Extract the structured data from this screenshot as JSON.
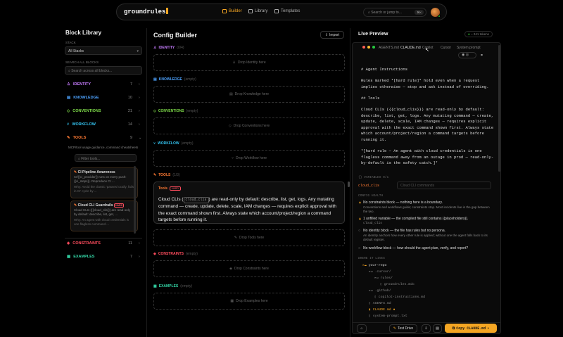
{
  "nav": {
    "brand": "groundrules",
    "tabs": [
      {
        "label": "Builder"
      },
      {
        "label": "Library"
      },
      {
        "label": "Templates"
      }
    ],
    "search_placeholder": "Search or jump to...",
    "search_kbd": "⌘K",
    "accent": "#f5a623"
  },
  "library": {
    "title": "Block Library",
    "stack_label": "STACK",
    "stack_value": "All Stacks",
    "search_label": "SEARCH ALL BLOCKS",
    "search_placeholder": "Search across all blocks...",
    "categories": [
      {
        "label": "IDENTITY",
        "count": "7",
        "color": "#c77dff"
      },
      {
        "label": "KNOWLEDGE",
        "count": "10",
        "color": "#4da3ff"
      },
      {
        "label": "CONVENTIONS",
        "count": "21",
        "color": "#7fdc4a"
      },
      {
        "label": "WORKFLOW",
        "count": "14",
        "color": "#33c3f0"
      },
      {
        "label": "TOOLS",
        "count": "9",
        "color": "#ff7a33"
      },
      {
        "label": "CONSTRAINTS",
        "count": "11",
        "color": "#ff4d5e"
      },
      {
        "label": "EXAMPLES",
        "count": "7",
        "color": "#33d6a6"
      }
    ],
    "tools_desc": "MCP/tool usage guidance, command cheatsheets",
    "tools_filter_placeholder": "Filter tools...",
    "cards": [
      {
        "title": "CI Pipeline Awareness",
        "body": "CI/{{ci_provider}} runs on every push: {{ci_steps}}. Reproduce CI ...",
        "why": "Why: Avoid the classic 'passes locally, fails in CI' cycle by ..."
      },
      {
        "title": "Cloud CLI Guardrails",
        "badge": "HARD",
        "body": "Cloud CLIs ({{cloud_clis}}) are read-only by default: describe, list, get, ...",
        "why": "Why: An agent with cloud credentials is one flagless command ..."
      }
    ]
  },
  "builder": {
    "title": "Config Builder",
    "import_label": "Import",
    "sections": [
      {
        "label": "IDENTITY",
        "tag": "(0/4)",
        "drop": "Drop Identity here",
        "color": "#c77dff"
      },
      {
        "label": "KNOWLEDGE",
        "tag": "(empty)",
        "drop": "Drop Knowledge here",
        "color": "#4da3ff"
      },
      {
        "label": "CONVENTIONS",
        "tag": "(empty)",
        "drop": "Drop Conventions here",
        "color": "#7fdc4a"
      },
      {
        "label": "WORKFLOW",
        "tag": "(empty)",
        "drop": "Drop Workflow here",
        "color": "#33c3f0"
      },
      {
        "label": "TOOLS",
        "tag": "(1/3)",
        "drop": "Drop Tools here",
        "color": "#ff7a33"
      },
      {
        "label": "CONSTRAINTS",
        "tag": "(empty)",
        "drop": "Drop Constraints here",
        "color": "#ff4d5e"
      },
      {
        "label": "EXAMPLES",
        "tag": "(empty)",
        "drop": "Drop Examples here",
        "color": "#33d6a6"
      }
    ],
    "tool_block": {
      "tag": "Tools",
      "badge": "HARD",
      "text_before": "Cloud CLIs (",
      "placeholder": "cloud_clis",
      "text_after": ") are read-only by default: describe, list, get, logs. Any mutating command — create, update, delete, scale, IAM changes — requires explicit approval with the exact command shown first. Always state which account/project/region a command targets before running it."
    }
  },
  "preview": {
    "title": "Live Preview",
    "tokens": "~ 241 tokens",
    "tabs": [
      {
        "label": "AGENTS.md"
      },
      {
        "label": "CLAUDE.md"
      },
      {
        "label": "Copilot"
      },
      {
        "label": "Cursor"
      },
      {
        "label": "System prompt"
      }
    ],
    "code": [
      "# Agent Instructions",
      "Rules marked *[hard rule]* hold even when a request implies otherwise — stop and ask instead of overriding.",
      "## Tools",
      "Cloud CLIs ({{cloud_clis}}) are read-only by default: describe, list, get, logs. Any mutating command — create, update, delete, scale, IAM changes — requires explicit approval with the exact command shown first. Always state which account/project/region a command targets before running it.",
      "*[hard rule — An agent with cloud credentials is one flagless command away from an outage in prod — read-only-by-default is the safety catch.]*"
    ],
    "variables_label": "{} VARIABLES 0/1",
    "variable_name": "cloud_clis",
    "variable_placeholder": "Cloud CLI commands",
    "health_label": "CONFIG HEALTH",
    "health": [
      {
        "title": "No constraints block — nothing here is a boundary.",
        "body": "Conventions and workflows guide; constraints stop. Most incidents live in the gap between the two."
      },
      {
        "title": "1 unfilled variable — the compiled file still contains {{placeholders}}.",
        "body": "cloud_clis"
      },
      {
        "title": "No identity block — the file has rules but no persona.",
        "body": "An identity anchors how every other rule is applied; without one the agent falls back to its default register."
      },
      {
        "title": "No workflow block — how should the agent plan, verify, and report?",
        "body": ""
      }
    ],
    "files_label": "WHERE IT LIVES",
    "tree": [
      {
        "name": "your-repo",
        "depth": 0,
        "type": "folder"
      },
      {
        "name": ".cursor/",
        "depth": 1,
        "type": "folder"
      },
      {
        "name": "rules/",
        "depth": 2,
        "type": "folder"
      },
      {
        "name": "groundrules.mdc",
        "depth": 3,
        "type": "file"
      },
      {
        "name": ".github/",
        "depth": 1,
        "type": "folder"
      },
      {
        "name": "copilot-instructions.md",
        "depth": 2,
        "type": "file"
      },
      {
        "name": "AGENTS.md",
        "depth": 1,
        "type": "file"
      },
      {
        "name": "CLAUDE.md",
        "depth": 1,
        "type": "active"
      },
      {
        "name": "system-prompt.txt",
        "depth": 1,
        "type": "file"
      }
    ],
    "test_drive": "Test Drive",
    "copy_label": "Copy CLAUDE.md"
  }
}
